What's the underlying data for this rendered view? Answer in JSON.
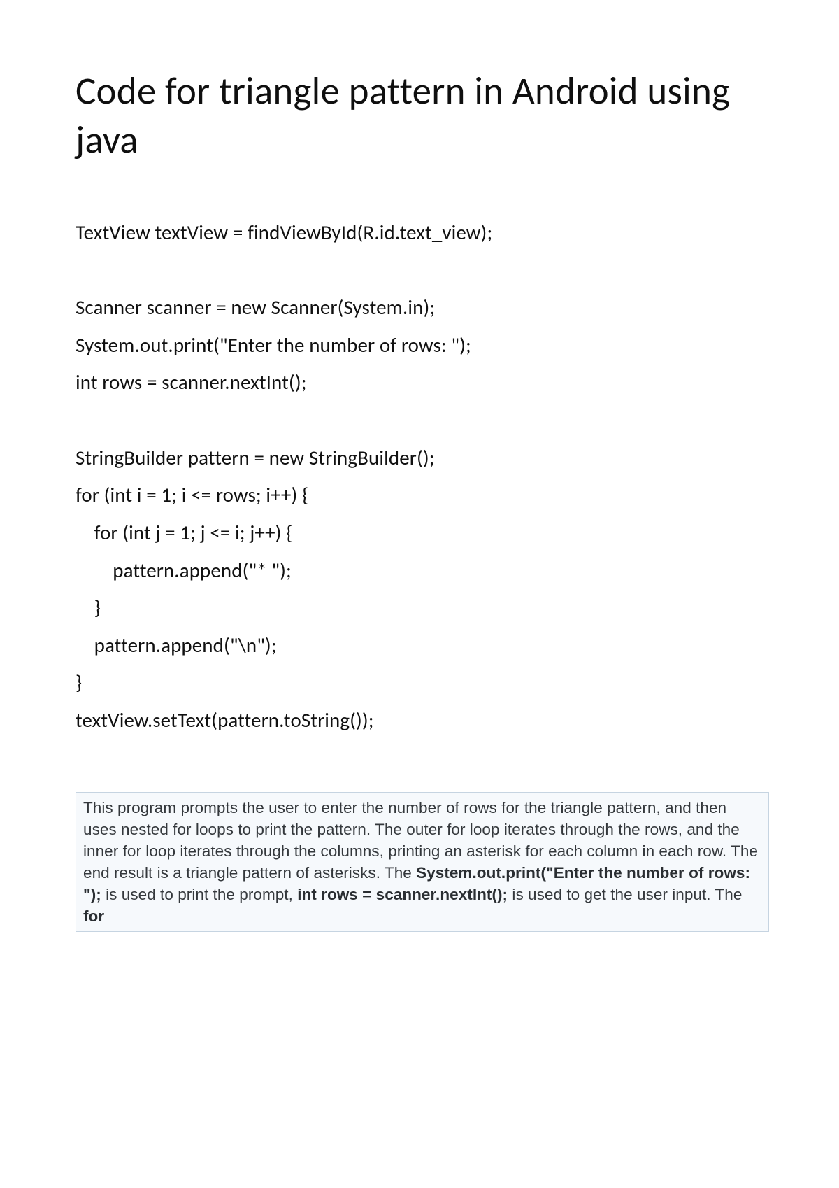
{
  "title": "Code for triangle pattern in Android using java",
  "code": "TextView textView = findViewById(R.id.text_view);\n\nScanner scanner = new Scanner(System.in);\nSystem.out.print(\"Enter the number of rows: \");\nint rows = scanner.nextInt();\n\nStringBuilder pattern = new StringBuilder();\nfor (int i = 1; i <= rows; i++) {\n    for (int j = 1; j <= i; j++) {\n        pattern.append(\"* \");\n    }\n    pattern.append(\"\\n\");\n}\ntextView.setText(pattern.toString());",
  "explain": {
    "t1": "This program prompts the user to enter the number of rows for the triangle pattern, and then uses nested for loops to print the pattern. The outer for loop iterates through the rows, and the inner for loop iterates through the columns, printing an asterisk for each column in each row. The end result is a triangle pattern of asterisks. The ",
    "b1": "System.out.print(\"Enter the number of rows: \");",
    "t2": " is used to print the prompt, ",
    "b2": "int rows = scanner.nextInt();",
    "t3": " is used to get the user input. The ",
    "b3": "for"
  }
}
